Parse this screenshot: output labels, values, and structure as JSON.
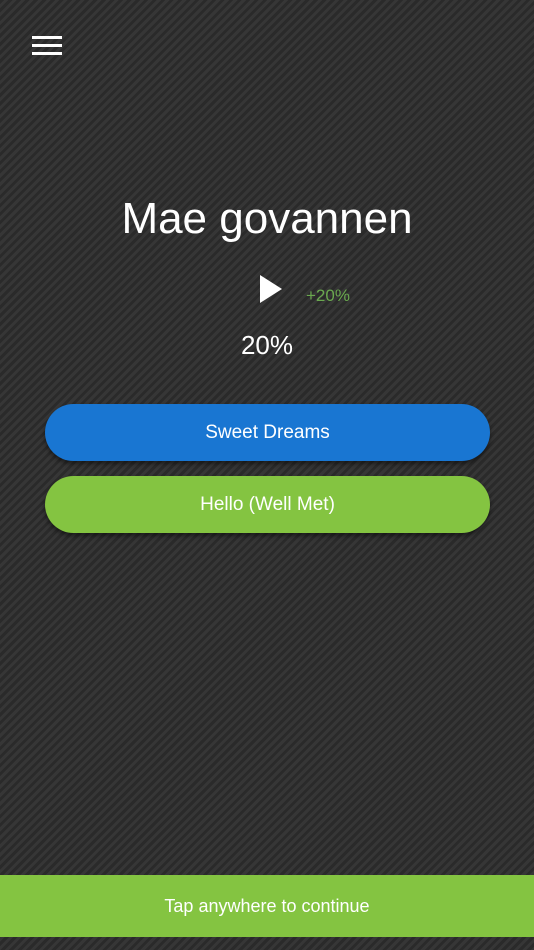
{
  "header": {
    "menu_icon": "hamburger-menu-icon"
  },
  "question": {
    "phrase": "Mae govannen",
    "play_icon": "play-icon",
    "bonus": "+20%",
    "progress": "20%"
  },
  "answers": [
    {
      "label": "Sweet Dreams",
      "color": "#1976d2"
    },
    {
      "label": "Hello (Well Met)",
      "color": "#84c441"
    }
  ],
  "footer": {
    "continue_label": "Tap anywhere to continue",
    "color": "#84c441"
  },
  "colors": {
    "accent_green": "#84c441",
    "accent_blue": "#1976d2",
    "bonus_green": "#6aa84f"
  }
}
